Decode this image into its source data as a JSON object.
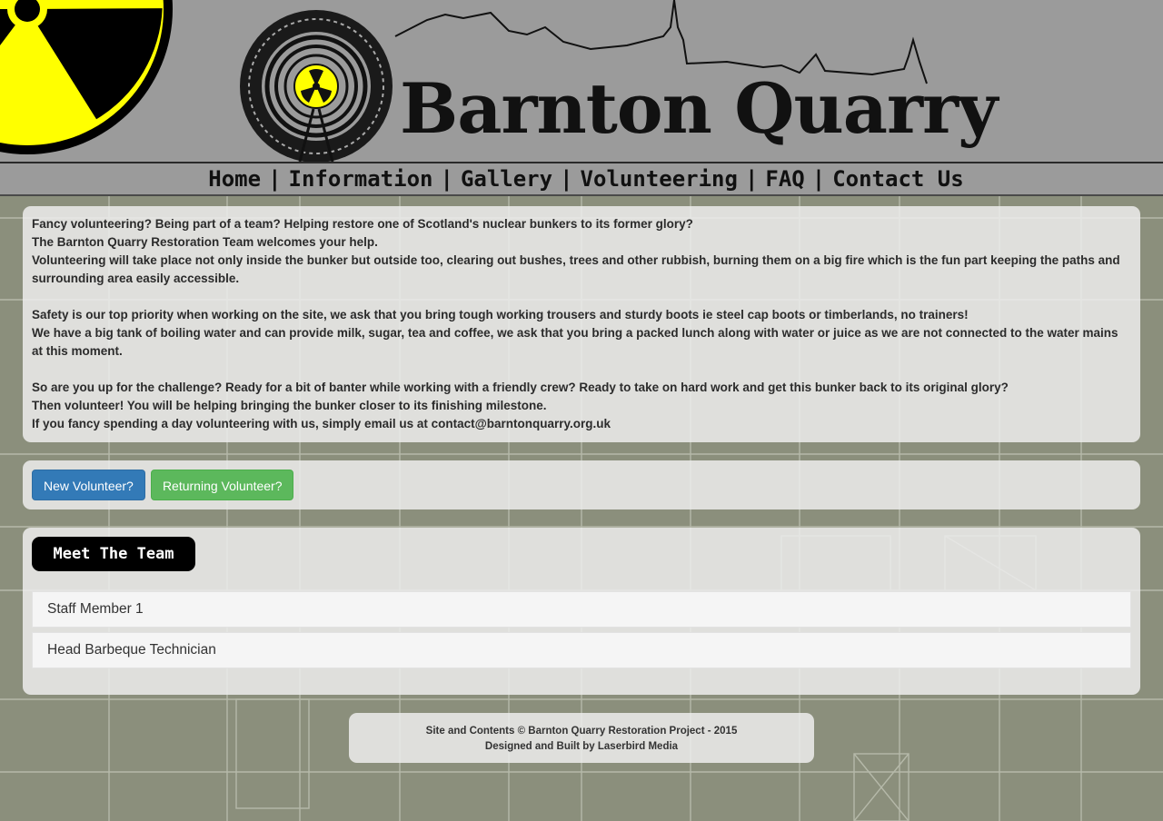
{
  "site": {
    "title": "Barnton Quarry"
  },
  "nav": {
    "items": [
      "Home",
      "Information",
      "Gallery",
      "Volunteering",
      "FAQ",
      "Contact Us"
    ]
  },
  "intro": {
    "lines": [
      "Fancy volunteering? Being part of a team? Helping restore one of Scotland's nuclear bunkers to its former glory?",
      "The Barnton Quarry Restoration Team welcomes your help.",
      "Volunteering will take place not only inside the bunker but outside too, clearing out bushes, trees and other rubbish, burning them on a big fire which is the fun part keeping the paths and surrounding area easily accessible.",
      "",
      "Safety is our top priority when working on the site, we ask that you bring tough working trousers and sturdy boots ie steel cap boots or timberlands, no trainers!",
      "We have a big tank of boiling water and can provide milk, sugar, tea and coffee, we ask that you bring a packed lunch along with water or juice as we are not connected to the water mains at this moment.",
      "",
      "So are you up for the challenge? Ready for a bit of banter while working with a friendly crew? Ready to take on hard work and get this bunker back to its original glory?",
      "Then volunteer! You will be helping bringing the bunker closer to its finishing milestone.",
      "If you fancy spending a day volunteering with us, simply email us at contact@barntonquarry.org.uk"
    ]
  },
  "buttons": {
    "new_volunteer": "New Volunteer?",
    "returning_volunteer": "Returning Volunteer?"
  },
  "team": {
    "heading": "Meet The Team",
    "members": [
      "Staff Member 1",
      "Head Barbeque Technician"
    ]
  },
  "footer": {
    "line1": "Site and Contents © Barnton Quarry Restoration Project - 2015",
    "line2": "Designed and Built by Laserbird Media"
  },
  "colors": {
    "header_bg": "#9b9b9b",
    "radiation_yellow": "#ffff00",
    "primary_button": "#337ab7",
    "success_button": "#5cb85c",
    "panel_bg": "#ececec"
  }
}
